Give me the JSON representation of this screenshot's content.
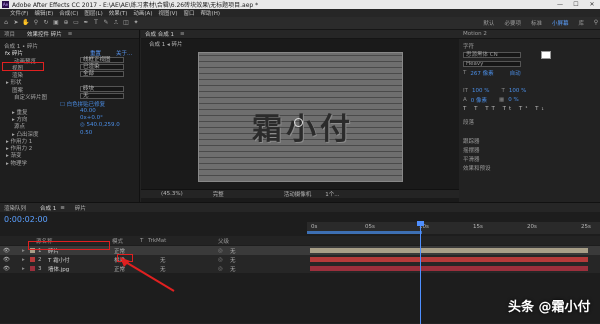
{
  "titlebar": {
    "title": "Adobe After Effects CC 2017 - E:\\AE\\AE\\练习素材\\合辑\\6.26砖块效果\\无标题项目.aep *",
    "min": "—",
    "max": "☐",
    "close": "✕"
  },
  "menu": [
    "文件(F)",
    "编辑(E)",
    "合成(C)",
    "图层(L)",
    "效果(T)",
    "动画(A)",
    "视图(V)",
    "窗口",
    "帮助(H)"
  ],
  "workspaces": [
    "默认",
    "必要项",
    "标准",
    "小屏幕",
    "库"
  ],
  "effect_panel": {
    "tabs": [
      "项目",
      "效果控件 碎片",
      "≡"
    ],
    "comp_label": "合成 1 • 碎片",
    "fx_name": "fx 碎片",
    "reset": "重置",
    "about": "关于...",
    "props": [
      {
        "label": "动画预览",
        "value": "线框正视图",
        "val_type": "select",
        "indent": "14"
      },
      {
        "label": "视图",
        "value": "已渲染",
        "val_type": "select",
        "indent": "12"
      },
      {
        "label": "渲染",
        "value": "全部",
        "val_type": "select",
        "indent": "12"
      },
      {
        "label": "▸ 形状",
        "value": "",
        "val_type": "",
        "indent": "6"
      },
      {
        "label": "图案",
        "value": "砖块",
        "val_type": "select",
        "indent": "12"
      },
      {
        "label": "自定义碎片图",
        "value": "无",
        "val_type": "select",
        "indent": "14"
      },
      {
        "label": "",
        "value": "☐ 白色拼贴已修复",
        "val_type": "",
        "indent": "66"
      },
      {
        "label": "▸ 重复",
        "value": "40.00",
        "val_type": "",
        "indent": "12"
      },
      {
        "label": "▸ 方向",
        "value": "0x+0.0°",
        "val_type": "",
        "indent": "12"
      },
      {
        "label": "源点",
        "value": "◎ 540.0,259.0",
        "val_type": "",
        "indent": "14"
      },
      {
        "label": "▸ 凸出深度",
        "value": "0.50",
        "val_type": "",
        "indent": "12"
      },
      {
        "label": "▸ 作用力 1",
        "value": "",
        "val_type": "",
        "indent": "6"
      },
      {
        "label": "▸ 作用力 2",
        "value": "",
        "val_type": "",
        "indent": "6"
      },
      {
        "label": "▸ 渐变",
        "value": "",
        "val_type": "",
        "indent": "6"
      },
      {
        "label": "▸ 物理学",
        "value": "",
        "val_type": "",
        "indent": "6"
      }
    ]
  },
  "viewer": {
    "tabs": [
      "合成 合成 1",
      "≡"
    ],
    "subtab": "合成 1 ◂ 碎片",
    "wall_text": "霜小付",
    "bar": [
      "(45.3%)",
      "完整",
      "活动摄像机",
      "1个..."
    ]
  },
  "right_panel": {
    "title": "Motion 2",
    "sections": [
      "字符",
      "段落",
      "跟踪器",
      "摇摆器",
      "平滑器",
      "效果和预设"
    ],
    "font": "思源黑体 CN",
    "style": "Heavy",
    "size": "267 像素",
    "tracking": "自动",
    "vscale": "100 %",
    "hscale": "100 %",
    "baseline": "0 像素",
    "tsume": "0 %"
  },
  "timeline": {
    "tabs": [
      "渲染队列",
      "合成 1",
      "≡",
      "碎片"
    ],
    "time": "0:00:02:00",
    "cols": [
      "源名称",
      "模式",
      "T",
      "TrkMat",
      "父级"
    ],
    "layers": [
      {
        "num": "1",
        "name": "碎片",
        "mode": "正常",
        "parent": "无",
        "color": "#a89f88"
      },
      {
        "num": "2",
        "name": "T 霜小付",
        "mode": "相乘",
        "trk": "无",
        "parent": "无",
        "color": "#b53a3a"
      },
      {
        "num": "3",
        "name": "墙体.jpg",
        "mode": "正常",
        "trk": "无",
        "parent": "无",
        "color": "#9b2f3c"
      }
    ],
    "ruler": [
      "0s",
      "05s",
      "10s",
      "15s",
      "20s",
      "25s"
    ]
  },
  "watermark": "头条 @霜小付"
}
